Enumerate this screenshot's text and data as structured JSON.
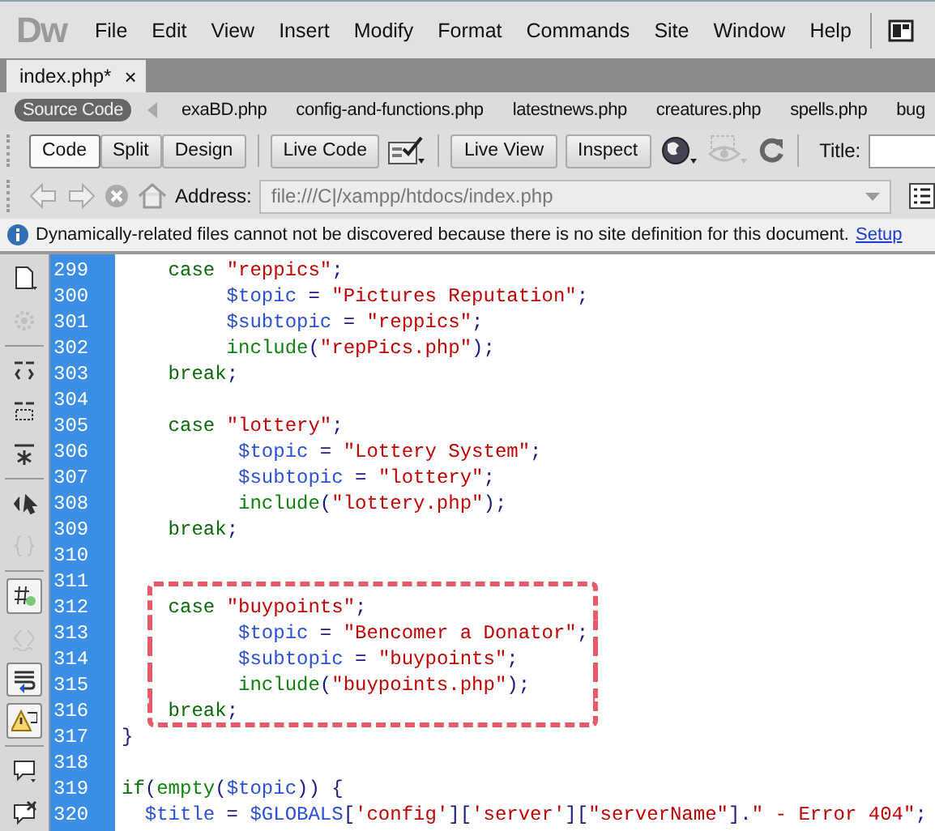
{
  "menu_bar": {
    "logo": "Dw",
    "items": [
      "File",
      "Edit",
      "View",
      "Insert",
      "Modify",
      "Format",
      "Commands",
      "Site",
      "Window",
      "Help"
    ]
  },
  "document_tabs": [
    {
      "label": "index.php*",
      "close": "×",
      "selected": true
    }
  ],
  "related_files": [
    {
      "label": "Source Code",
      "selected": true
    },
    {
      "label": "exaBD.php",
      "selected": false
    },
    {
      "label": "config-and-functions.php",
      "selected": false
    },
    {
      "label": "latestnews.php",
      "selected": false
    },
    {
      "label": "creatures.php",
      "selected": false
    },
    {
      "label": "spells.php",
      "selected": false
    },
    {
      "label": "bug",
      "selected": false
    }
  ],
  "view_buttons": [
    {
      "label": "Code",
      "selected": true
    },
    {
      "label": "Split",
      "selected": false
    },
    {
      "label": "Design",
      "selected": false
    }
  ],
  "live_buttons": [
    "Live Code",
    "Live View",
    "Inspect"
  ],
  "title_field": {
    "label": "Title:"
  },
  "address_bar": {
    "label": "Address:",
    "value": "file:///C|/xampp/htdocs/index.php"
  },
  "info_bar": {
    "message": "Dynamically-related files cannot not be discovered because there is no site definition for this document.",
    "link": "Setup"
  },
  "side_toolbar": [
    {
      "kind": "new-file",
      "on": false,
      "disabled": false
    },
    {
      "kind": "gear",
      "on": false,
      "disabled": true
    },
    {
      "kind": "sep"
    },
    {
      "kind": "collapse-tag",
      "on": false,
      "disabled": false
    },
    {
      "kind": "collapse-selection",
      "on": false,
      "disabled": false
    },
    {
      "kind": "expand-all",
      "on": false,
      "disabled": false
    },
    {
      "kind": "sep"
    },
    {
      "kind": "select-parent",
      "on": false,
      "disabled": false
    },
    {
      "kind": "braces",
      "on": false,
      "disabled": true
    },
    {
      "kind": "sep"
    },
    {
      "kind": "line-numbers",
      "on": true,
      "disabled": false
    },
    {
      "kind": "invalid-code",
      "on": false,
      "disabled": true
    },
    {
      "kind": "word-wrap",
      "on": true,
      "disabled": false
    },
    {
      "kind": "syntax-error",
      "on": true,
      "disabled": false
    },
    {
      "kind": "sep"
    },
    {
      "kind": "comment",
      "on": false,
      "disabled": false
    },
    {
      "kind": "uncomment",
      "on": false,
      "disabled": false
    }
  ],
  "code_lines": [
    {
      "number": "299",
      "highlighted": false,
      "tokens": [
        {
          "kind": "kw",
          "text": "    case "
        },
        {
          "kind": "str",
          "text": "\"reppics\""
        },
        {
          "kind": "punc",
          "text": ";"
        }
      ]
    },
    {
      "number": "300",
      "highlighted": false,
      "tokens": [
        {
          "kind": "var",
          "text": "         $topic"
        },
        {
          "kind": "punc",
          "text": " = "
        },
        {
          "kind": "str",
          "text": "\"Pictures Reputation\""
        },
        {
          "kind": "punc",
          "text": ";"
        }
      ]
    },
    {
      "number": "301",
      "highlighted": false,
      "tokens": [
        {
          "kind": "var",
          "text": "         $subtopic"
        },
        {
          "kind": "punc",
          "text": " = "
        },
        {
          "kind": "str",
          "text": "\"reppics\""
        },
        {
          "kind": "punc",
          "text": ";"
        }
      ]
    },
    {
      "number": "302",
      "highlighted": false,
      "tokens": [
        {
          "kind": "fn",
          "text": "         include"
        },
        {
          "kind": "punc",
          "text": "("
        },
        {
          "kind": "str",
          "text": "\"repPics.php\""
        },
        {
          "kind": "punc",
          "text": ");"
        }
      ]
    },
    {
      "number": "303",
      "highlighted": false,
      "tokens": [
        {
          "kind": "kw",
          "text": "    break"
        },
        {
          "kind": "punc",
          "text": ";"
        }
      ]
    },
    {
      "number": "304",
      "highlighted": false
    },
    {
      "number": "305",
      "highlighted": false,
      "tokens": [
        {
          "kind": "kw",
          "text": "    case "
        },
        {
          "kind": "str",
          "text": "\"lottery\""
        },
        {
          "kind": "punc",
          "text": ";"
        }
      ]
    },
    {
      "number": "306",
      "highlighted": false,
      "tokens": [
        {
          "kind": "var",
          "text": "          $topic"
        },
        {
          "kind": "punc",
          "text": " = "
        },
        {
          "kind": "str",
          "text": "\"Lottery System\""
        },
        {
          "kind": "punc",
          "text": ";"
        }
      ]
    },
    {
      "number": "307",
      "highlighted": false,
      "tokens": [
        {
          "kind": "var",
          "text": "          $subtopic"
        },
        {
          "kind": "punc",
          "text": " = "
        },
        {
          "kind": "str",
          "text": "\"lottery\""
        },
        {
          "kind": "punc",
          "text": ";"
        }
      ]
    },
    {
      "number": "308",
      "highlighted": false,
      "tokens": [
        {
          "kind": "fn",
          "text": "          include"
        },
        {
          "kind": "punc",
          "text": "("
        },
        {
          "kind": "str",
          "text": "\"lottery.php\""
        },
        {
          "kind": "punc",
          "text": ");"
        }
      ]
    },
    {
      "number": "309",
      "highlighted": false,
      "tokens": [
        {
          "kind": "kw",
          "text": "    break"
        },
        {
          "kind": "punc",
          "text": ";"
        }
      ]
    },
    {
      "number": "310",
      "highlighted": false
    },
    {
      "number": "311",
      "highlighted": false
    },
    {
      "number": "312",
      "highlighted": true,
      "tokens": [
        {
          "kind": "kw",
          "text": "    case "
        },
        {
          "kind": "str",
          "text": "\"buypoints\""
        },
        {
          "kind": "punc",
          "text": ";"
        }
      ]
    },
    {
      "number": "313",
      "highlighted": true,
      "tokens": [
        {
          "kind": "var",
          "text": "          $topic"
        },
        {
          "kind": "punc",
          "text": " = "
        },
        {
          "kind": "str",
          "text": "\"Bencomer a Donator\""
        },
        {
          "kind": "punc",
          "text": ";"
        }
      ]
    },
    {
      "number": "314",
      "highlighted": true,
      "tokens": [
        {
          "kind": "var",
          "text": "          $subtopic"
        },
        {
          "kind": "punc",
          "text": " = "
        },
        {
          "kind": "str",
          "text": "\"buypoints\""
        },
        {
          "kind": "punc",
          "text": ";"
        }
      ]
    },
    {
      "number": "315",
      "highlighted": true,
      "tokens": [
        {
          "kind": "fn",
          "text": "          include"
        },
        {
          "kind": "punc",
          "text": "("
        },
        {
          "kind": "str",
          "text": "\"buypoints.php\""
        },
        {
          "kind": "punc",
          "text": ");"
        }
      ]
    },
    {
      "number": "316",
      "highlighted": true,
      "tokens": [
        {
          "kind": "kw",
          "text": "    break"
        },
        {
          "kind": "punc",
          "text": ";"
        }
      ]
    },
    {
      "number": "317",
      "highlighted": false,
      "tokens": [
        {
          "kind": "punc",
          "text": "}"
        }
      ]
    },
    {
      "number": "318",
      "highlighted": false
    },
    {
      "number": "319",
      "highlighted": false,
      "tokens": [
        {
          "kind": "kw",
          "text": "if"
        },
        {
          "kind": "punc",
          "text": "("
        },
        {
          "kind": "fn",
          "text": "empty"
        },
        {
          "kind": "punc",
          "text": "("
        },
        {
          "kind": "var",
          "text": "$topic"
        },
        {
          "kind": "punc",
          "text": ")) {"
        }
      ]
    },
    {
      "number": "320",
      "highlighted": false,
      "tokens": [
        {
          "kind": "var",
          "text": "  $title"
        },
        {
          "kind": "punc",
          "text": " = "
        },
        {
          "kind": "var",
          "text": "$GLOBALS"
        },
        {
          "kind": "punc",
          "text": "["
        },
        {
          "kind": "str",
          "text": "'config'"
        },
        {
          "kind": "punc",
          "text": "]["
        },
        {
          "kind": "str",
          "text": "'server'"
        },
        {
          "kind": "punc",
          "text": "]["
        },
        {
          "kind": "str",
          "text": "\"serverName\""
        },
        {
          "kind": "punc",
          "text": "]."
        },
        {
          "kind": "str",
          "text": "\" - Error 404\""
        },
        {
          "kind": "punc",
          "text": ";"
        }
      ]
    }
  ]
}
